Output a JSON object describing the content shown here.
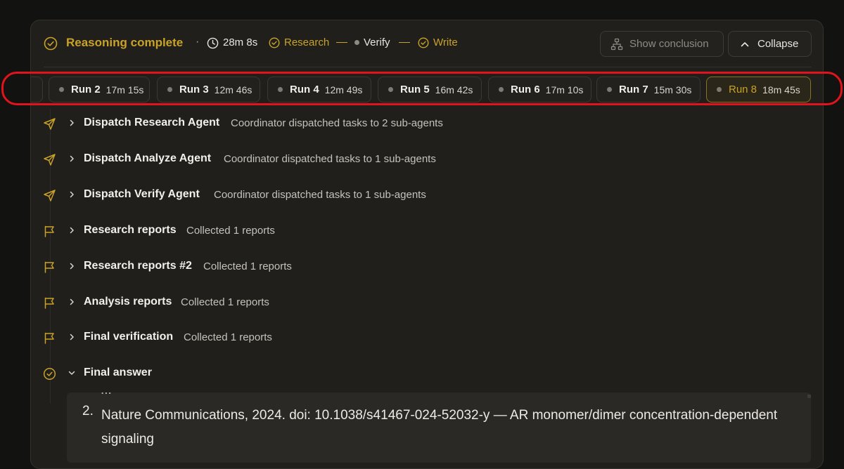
{
  "header": {
    "title": "Reasoning complete",
    "separator": "·",
    "elapsed": "28m 8s",
    "stages": [
      {
        "label": "Research",
        "state": "done"
      },
      {
        "label": "Verify",
        "state": "pending"
      },
      {
        "label": "Write",
        "state": "done"
      }
    ],
    "show_conclusion_label": "Show conclusion",
    "collapse_label": "Collapse"
  },
  "runs": [
    {
      "name": "Run 2",
      "time": "17m 15s"
    },
    {
      "name": "Run 3",
      "time": "12m 46s"
    },
    {
      "name": "Run 4",
      "time": "12m 49s"
    },
    {
      "name": "Run 5",
      "time": "16m 42s"
    },
    {
      "name": "Run 6",
      "time": "17m 10s"
    },
    {
      "name": "Run 7",
      "time": "15m 30s"
    },
    {
      "name": "Run 8",
      "time": "18m 45s",
      "active": true
    }
  ],
  "steps": [
    {
      "title": "Dispatch Research Agent",
      "desc": "Coordinator dispatched tasks to 2 sub-agents",
      "icon": "send-icon"
    },
    {
      "title": "Dispatch Analyze Agent",
      "desc": "Coordinator dispatched tasks to 1 sub-agents",
      "icon": "send-icon"
    },
    {
      "title": "Dispatch Verify Agent",
      "desc": "Coordinator dispatched tasks to 1 sub-agents",
      "icon": "send-icon"
    },
    {
      "title": "Research reports",
      "desc": "Collected 1 reports",
      "icon": "flag-icon"
    },
    {
      "title": "Research reports #2",
      "desc": "Collected 1 reports",
      "icon": "flag-icon"
    },
    {
      "title": "Analysis reports",
      "desc": "Collected 1 reports",
      "icon": "flag-icon"
    },
    {
      "title": "Final verification",
      "desc": "Collected 1 reports",
      "icon": "flag-icon"
    },
    {
      "title": "Final answer",
      "desc": "",
      "icon": "check-circle-icon",
      "expanded": true
    }
  ],
  "answer": {
    "clipped_line": "...",
    "item_number": "2.",
    "item_text": "Nature Communications, 2024. doi: 10.1038/s41467-024-52032-y — AR monomer/dimer concentration-dependent signaling"
  },
  "colors": {
    "accent": "#c9a227",
    "highlight": "#e0141c",
    "panel": "#201f1c",
    "background": "#121210"
  }
}
